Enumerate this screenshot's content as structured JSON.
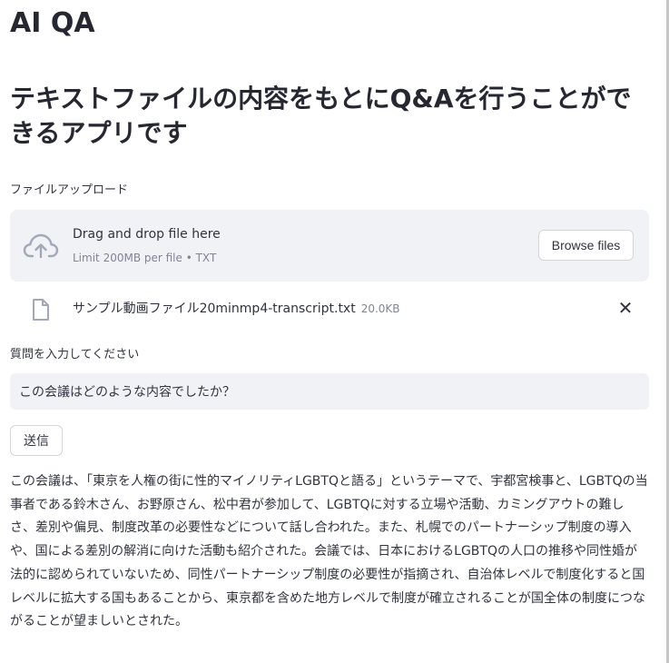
{
  "app": {
    "title": "AI QA",
    "subtitle": "テキストファイルの内容をもとにQ&Aを行うことができるアプリです"
  },
  "uploader": {
    "label": "ファイルアップロード",
    "drop_text": "Drag and drop file here",
    "limit_text": "Limit 200MB per file • TXT",
    "browse_label": "Browse files",
    "icon": "cloud-upload-icon"
  },
  "uploaded_file": {
    "name": "サンプル動画ファイル20minmp4-transcript.txt",
    "size": "20.0KB",
    "icon": "file-icon",
    "remove_label": "✕"
  },
  "question": {
    "label": "質問を入力してください",
    "value": "この会議はどのような内容でしたか？"
  },
  "submit": {
    "label": "送信"
  },
  "answer": {
    "text": "この会議は、「東京を人権の街に性的マイノリティLGBTQと語る」というテーマで、宇都宮検事と、LGBTQの当事者である鈴木さん、お野原さん、松中君が参加して、LGBTQに対する立場や活動、カミングアウトの難しさ、差別や偏見、制度改革の必要性などについて話し合われた。また、札幌でのパートナーシップ制度の導入や、国による差別の解消に向けた活動も紹介された。会議では、日本におけるLGBTQの人口の推移や同性婚が法的に認められていないため、同性パートナーシップ制度の必要性が指摘され、自治体レベルで制度化すると国レベルに拡大する国もあることから、東京都を含めた地方レベルで制度が確立されることが国全体の制度につながることが望ましいとされた。"
  },
  "colors": {
    "text": "#31333f",
    "muted": "#808495",
    "panel": "#f0f2f6",
    "icon": "#a3a8b8"
  }
}
